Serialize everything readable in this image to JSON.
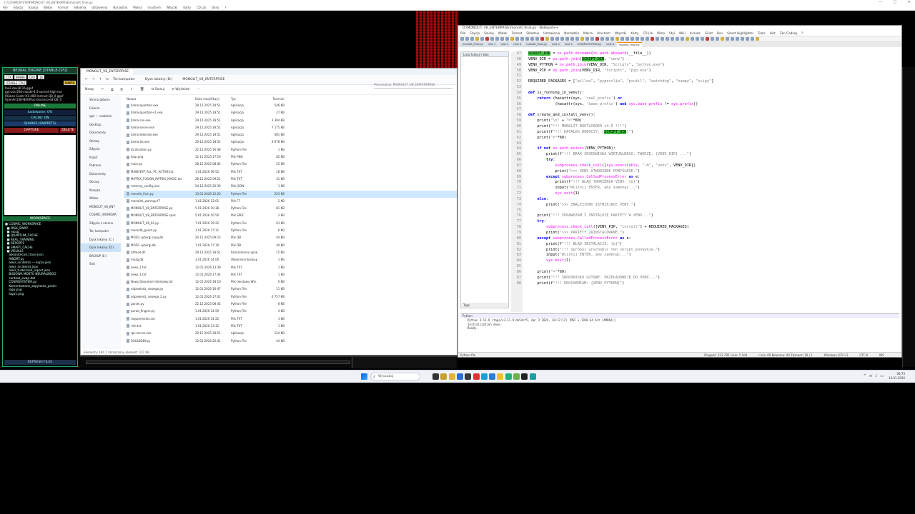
{
  "top_title": "C:\\COSMOSYSTEM\\MONOLIT_V8_ENTERPRISE\\monolit_final.py",
  "top_menu": [
    "File",
    "Edycja",
    "Szukaj",
    "Widok",
    "Format",
    "Składnia",
    "Ustawienia",
    "Narzędzia",
    "Makra",
    "Uruchom",
    "Wtyczki",
    "Karty",
    "CD Lib",
    "Okno",
    "?"
  ],
  "top_ctrls": [
    "—",
    "□",
    "✕"
  ],
  "neural": {
    "header": "NEURAL ENGINE [STABLE-CPU]",
    "chips": [
      "CTX",
      "99999",
      "CPU",
      "16"
    ],
    "status_chip": "[STABLE CPU]",
    "ignite": "IGNITE",
    "models": [
      "fox2-dev-BF16.gguf",
      "gpt-oss-20b-claude-4.5-sonnet-high-rea",
      "RQwen-Coder-V3-40B-Instruct.Q8_0.gguf",
      "OpenAI-20B-NEOPlus-Uncensored-Q8_0"
    ],
    "online": "ONLINE",
    "loading": "Ładowanie: 0%",
    "cache": "CACHE: ON",
    "quarks": "QUARKS (SNIPPETS)",
    "capture": "CAPTURE",
    "delete": "DELETE",
    "workspace_header": "WORKSPACE",
    "workspace_items": [
      "■ COSMIC_WORKSPACE",
      "  ■ DISK_SWAP",
      "  ■ mozg",
      "  ■ QUANTUM_CACHE",
      "  ■ REAL_TRAINING",
      "  ■ REPORTS",
      "  ■ SMART_CACHE",
      "  ■ VISUALS",
      "    absolutecod_trace.json",
      "    AIBORT.py",
      "    aiwir_incidents — kopia.json",
      "    aiwir_incidents.json",
      "    aiwir_turbocash_report.json",
      "    BUDOWA MOSTU NEURALNEGO",
      "    context_swap.dat",
      "    COSMOSYSTEM.py",
      "    Komentowane_zapytania_prodn",
      "    logo.png",
      "    logo1.png"
    ],
    "refresh": "REFRESH FILES"
  },
  "explorer": {
    "tab": "MONOLIT_V8_ENTERPRISE",
    "breadcrumbs": [
      "Ten komputer",
      "Dysk lokalny (D:)",
      "MONOLIT_V8_ENTERPRISE"
    ],
    "search_placeholder": "Przeszukaj: MONOLIT_V8_ENTERPRISE",
    "cmd": [
      "Nowy",
      "✂",
      "⧉",
      "⎘",
      "⇪",
      "🗑",
      "⇅ Sortuj",
      "≡ Wyświetl",
      "⋯"
    ],
    "side": [
      "Strona główna",
      "Galeria",
      "igor — osobiste",
      "Desktop",
      "Dokumenty",
      "Obrazy",
      "Zdjęcia",
      "Pulpit",
      "Pobrane",
      "Dokumenty",
      "Obrazy",
      "Muzyka",
      "Wideo",
      "MONOLIT_V8_ENT",
      "COSMIC_WORKSPA",
      "Zdjęcia z ekranu",
      "Ten komputer",
      "Dysk lokalny (C:)",
      "Dysk lokalny (D:)",
      "BACKUP (E:)",
      "Sieć"
    ],
    "columns": [
      "Nazwa",
      "Data modyfikacji",
      "Typ",
      "Rozmiar"
    ],
    "files": [
      {
        "n": "llama-quantize.exe",
        "d": "29.12.2025 18:51",
        "t": "Aplikacja",
        "s": "546 KB"
      },
      {
        "n": "llama-quantize-v1.exe",
        "d": "29.12.2025 18:51",
        "t": "Aplikacja",
        "s": "27 KB"
      },
      {
        "n": "llama-run.exe",
        "d": "29.12.2025 18:51",
        "t": "Aplikacja",
        "s": "2 394 KB"
      },
      {
        "n": "llama-server.exe",
        "d": "29.12.2025 18:51",
        "t": "Aplikacja",
        "s": "7 175 KB"
      },
      {
        "n": "llama-tokenize.exe",
        "d": "29.12.2025 18:51",
        "t": "Aplikacja",
        "s": "481 KB"
      },
      {
        "n": "llama-tts.exe",
        "d": "29.12.2025 18:51",
        "t": "Aplikacja",
        "s": "2 678 KB"
      },
      {
        "n": "localization.py",
        "d": "22.12.2025 16:48",
        "t": "Python File",
        "s": "1 KB"
      },
      {
        "n": "loop.png",
        "d": "12.11.2025 17:19",
        "t": "Plik PNG",
        "s": "82 KB"
      },
      {
        "n": "main.py",
        "d": "28.12.2025 08:02",
        "t": "Python File",
        "s": "25 KB"
      },
      {
        "n": "MANIFEST_ALL_PC_ACTIVE.txt",
        "d": "1.01.2026 09:52",
        "t": "Plik TXT",
        "s": "18 KB"
      },
      {
        "n": "MATRIX_FUSION_MATRIX_MAGIC.txt",
        "d": "28.12.2025 09:21",
        "t": "Plik TXT",
        "s": "41 KB"
      },
      {
        "n": "memory_config.json",
        "d": "24.12.2025 20:39",
        "t": "Plik JSON",
        "s": "1 KB"
      },
      {
        "n": "monolit_final.py",
        "d": "13.01.2026 12:20",
        "t": "Python File",
        "s": "223 KB"
      },
      {
        "n": "monolite_warmup.f7",
        "d": "1.01.2026 12:01",
        "t": "Plik F7",
        "s": "2 KB"
      },
      {
        "n": "MONOLIT_V8_ENTERPRISE.py",
        "d": "5.01.2026 10:38",
        "t": "Python File",
        "s": "81 KB"
      },
      {
        "n": "MONOLIT_V8_ENTERPRISE.spec",
        "d": "5.01.2026 10:50",
        "t": "Plik SPEC",
        "s": "2 KB"
      },
      {
        "n": "MONOLIT_V8_02.py",
        "d": "7.01.2026 19:22",
        "t": "Python File",
        "s": "63 KB"
      },
      {
        "n": "moondb_guard.py",
        "d": "1.01.2026 17:11",
        "t": "Python File",
        "s": "6 KB"
      },
      {
        "n": "MOZG cyborgi copy.db",
        "d": "20.12.2025 09:23",
        "t": "Plik DB",
        "s": "44 KB"
      },
      {
        "n": "MOZG cyborgi.db",
        "d": "1.01.2026 17:10",
        "t": "Plik DB",
        "s": "40 KB"
      },
      {
        "n": "ntfmod.dll",
        "d": "29.12.2025 18:51",
        "t": "Rozszerzenie aplik.",
        "s": "15 KB"
      },
      {
        "n": "mozg.db",
        "d": "3.01.2026 14:00",
        "t": "Utworzono backup",
        "s": "1 KB"
      },
      {
        "n": "news_1.txt",
        "d": "12.01.2026 13:39",
        "t": "Plik TXT",
        "s": "1 KB"
      },
      {
        "n": "news_1.txt",
        "d": "12.01.2026 17:44",
        "t": "Plik TXT",
        "s": "1 KB"
      },
      {
        "n": "Nowy Dokument tekstowy.txt",
        "d": "12.01.2026 18:10",
        "t": "Plik tekstowy Win.",
        "s": "0 KB"
      },
      {
        "n": "odpowiedz_nowego.py",
        "d": "12.01.2026 16:47",
        "t": "Python File",
        "s": "11 KB"
      },
      {
        "n": "odpowiedz_nowego_2.py",
        "d": "12.01.2026 17:01",
        "t": "Python File",
        "s": "6 757 KB"
      },
      {
        "n": "parser.py",
        "d": "22.12.2025 08:45",
        "t": "Python File",
        "s": "8 KB"
      },
      {
        "n": "portal_fingers.py",
        "d": "1.01.2026 14:59",
        "t": "Python File",
        "s": "4 KB"
      },
      {
        "n": "requirements.txt",
        "d": "1.01.2026 14:22",
        "t": "Plik TXT",
        "s": "1 KB"
      },
      {
        "n": "rich.txt",
        "d": "1.01.2026 13:32",
        "t": "Plik TXT",
        "s": "1 KB"
      },
      {
        "n": "rpc-server.exe",
        "d": "29.12.2025 18:51",
        "t": "Aplikacja",
        "s": "124 KB"
      },
      {
        "n": "SOULBODY.py",
        "d": "12.01.2026 20:41",
        "t": "Python File",
        "s": "44 KB"
      }
    ],
    "selected_index": 12,
    "status": "Elementy: 184   1 zaznaczony element: 222 KB"
  },
  "npp": {
    "title": "D:\\MONOLIT_V8_ENTERPRISE\\monolit_final.py - Notepad++",
    "menu": [
      "Plik",
      "Edycja",
      "Szukaj",
      "Widok",
      "Format",
      "Składnia",
      "Ustawienia",
      "Narzędzia",
      "Makra",
      "Uruchom",
      "Wtyczki",
      "Karty",
      "CD Lib",
      "Okno",
      "Styl",
      "Wiki",
      "Include",
      "Gilint",
      "Run",
      "Smart Highlighter",
      "Tools",
      "Hist",
      "Zen Coding",
      "?"
    ],
    "tabs": [
      "monolit_final.py",
      "new 1",
      "new 2",
      "new 3",
      "monolit_final.py",
      "new 4",
      "new 5",
      "COSMOSYSTEM.py",
      "new 6",
      "monolit_final.py"
    ],
    "func_header": "Lista funkcji i klas",
    "func_footer": "Tags",
    "line_start": 47,
    "code": [
      "SCRIPT_DIR = os.path.dirname(os.path.abspath(__file__))",
      "VENV_DIR = os.path.join(SCRIPT_DIR, \"venv\")",
      "VENV_PYTHON = os.path.join(VENV_DIR, \"Scripts\", \"python.exe\")",
      "VENV_PIP = os.path.join(VENV_DIR, \"Scripts\", \"pip.exe\")",
      "",
      "REQUIRED_PACKAGES = [\"pillow\", \"pyperclip\", \"psutil\", \"watchdog\", \"numpy\", \"scipy\"]",
      "",
      "def is_running_in_venv():",
      "    return (hasattr(sys, 'real_prefix') or",
      "            (hasattr(sys, 'base_prefix') and sys.base_prefix != sys.prefix))",
      "",
      "def create_and_install_venv():",
      "    print(\"\\n\" + \"=\"*60)",
      "    print(\"!!! MONOLIT BOOTLOADER v4.5 !!!\")",
      "    print(f\"!!! KATALOG ROBOCZY: {SCRIPT_DIR}\")",
      "    print(\"=\"*60)",
      "",
      "    if not os.path.exists(VENV_PYTHON):",
      "        print(f\"!!! BRAK ŚRODOWISKA WIRTUALNEGO. TWORZĘ: {VENV_DIR} ...\")",
      "        try:",
      "            subprocess.check_call([sys.executable, \"-m\", \"venv\", VENV_DIR])",
      "            print(\">>> VENV UTWORZONE POMYŚLNIE.\")",
      "        except subprocess.CalledProcessError as e:",
      "            print(f\"!!! BŁĄD TWORZENIA VENV: {e}\")",
      "            input(\"Wciśnij ENTER, aby zamknąć...\")",
      "            sys.exit(1)",
      "    else:",
      "        print(\">>> ZNALEZIONO ISTNIEJĄCE VENV.\")",
      "",
      "    print(\"!!! SPRAWDZAM I INSTALUJĘ PAKIETY W VENV...\")",
      "    try:",
      "        subprocess.check_call([VENV_PIP, \"install\"] + REQUIRED_PACKAGES)",
      "        print(\">>> PAKIETY ZAINSTALOWANE.\")",
      "    except subprocess.CalledProcessError as e:",
      "        print(f\"!!! BŁĄD INSTALACJI: {e}\")",
      "        print(\"!!! Spróbuj uruchomić ten skrypt ponownie.\")",
      "        input(\"Wciśnij ENTER, aby zamknąć...\")",
      "        sys.exit(1)",
      "",
      "    print(\"=\"*60)",
      "    print(\"!!! ŚRODOWISKO GOTOWE. PRZEŁADOWUJĘ DO VENV...\")",
      "    print(f\"!!! URUCHAMIAM: {VENV_PYTHON}\")"
    ],
    "output_header": "Python",
    "output_lines": [
      "Python 3.11.9 (tags/v3.11.9:de54cf5, Apr  2 2024, 10:12:12) [MSC v.1938 64 bit (AMD64)]",
      "Initialization done.",
      "Ready."
    ],
    "status": [
      "Python file",
      "Długość: 223 785   Linie: 5 104",
      "Linia: 60   Kolumna: 40   Zaznacz: 10 | 1",
      "Windows (CR LF)",
      "UTF-8",
      "INS"
    ]
  },
  "taskbar": {
    "search": "Wyszukaj",
    "clock_time": "06:73",
    "clock_date": "14.01.2026",
    "icons": [
      {
        "name": "task-view-icon",
        "color": "#333"
      },
      {
        "name": "widgets-icon",
        "color": "#c8a030"
      },
      {
        "name": "file-explorer-icon",
        "color": "#e2b33c"
      },
      {
        "name": "store-icon",
        "color": "#2b6fd6"
      },
      {
        "name": "terminal-icon",
        "color": "#3a3a3a"
      },
      {
        "name": "chrome-icon",
        "color": "#d33"
      },
      {
        "name": "edge-icon",
        "color": "#1aa0d8"
      },
      {
        "name": "vscode-icon",
        "color": "#2a7fd4"
      },
      {
        "name": "python-icon",
        "color": "#f0c030"
      },
      {
        "name": "pycharm-icon",
        "color": "#22b07a"
      },
      {
        "name": "notepadpp-icon",
        "color": "#6ab04c"
      },
      {
        "name": "console-icon",
        "color": "#222"
      },
      {
        "name": "app-icon",
        "color": "#1aa0a0"
      }
    ]
  }
}
